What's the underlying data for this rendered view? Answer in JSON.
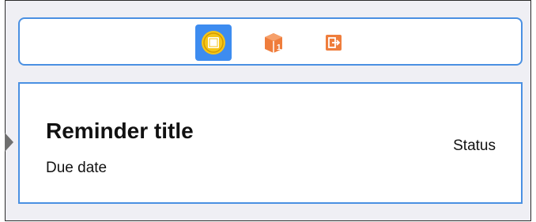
{
  "toolbar": {
    "icons": [
      {
        "name": "view-controller-icon",
        "selected": true,
        "color": "#f5c518"
      },
      {
        "name": "first-responder-icon",
        "selected": false,
        "color": "#ef7d3c"
      },
      {
        "name": "exit-icon",
        "selected": false,
        "color": "#ef7d3c"
      }
    ],
    "selected_background": "#3d8cf0"
  },
  "cell": {
    "title": "Reminder title",
    "due_date": "Due date",
    "status": "Status"
  },
  "colors": {
    "selection_border": "#4a90e2",
    "canvas_background": "#efeff4"
  }
}
